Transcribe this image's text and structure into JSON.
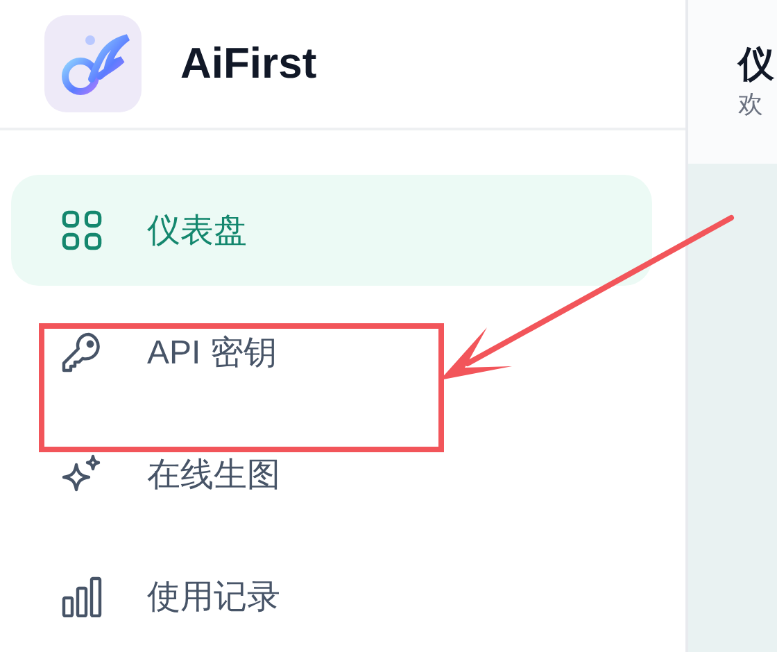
{
  "brand": {
    "name": "AiFirst"
  },
  "nav": [
    {
      "label": "仪表盘",
      "selected": true
    },
    {
      "label": "API 密钥",
      "selected": false
    },
    {
      "label": "在线生图",
      "selected": false
    },
    {
      "label": "使用记录",
      "selected": false
    }
  ],
  "header": {
    "title": "仪",
    "subtitle": "欢"
  }
}
